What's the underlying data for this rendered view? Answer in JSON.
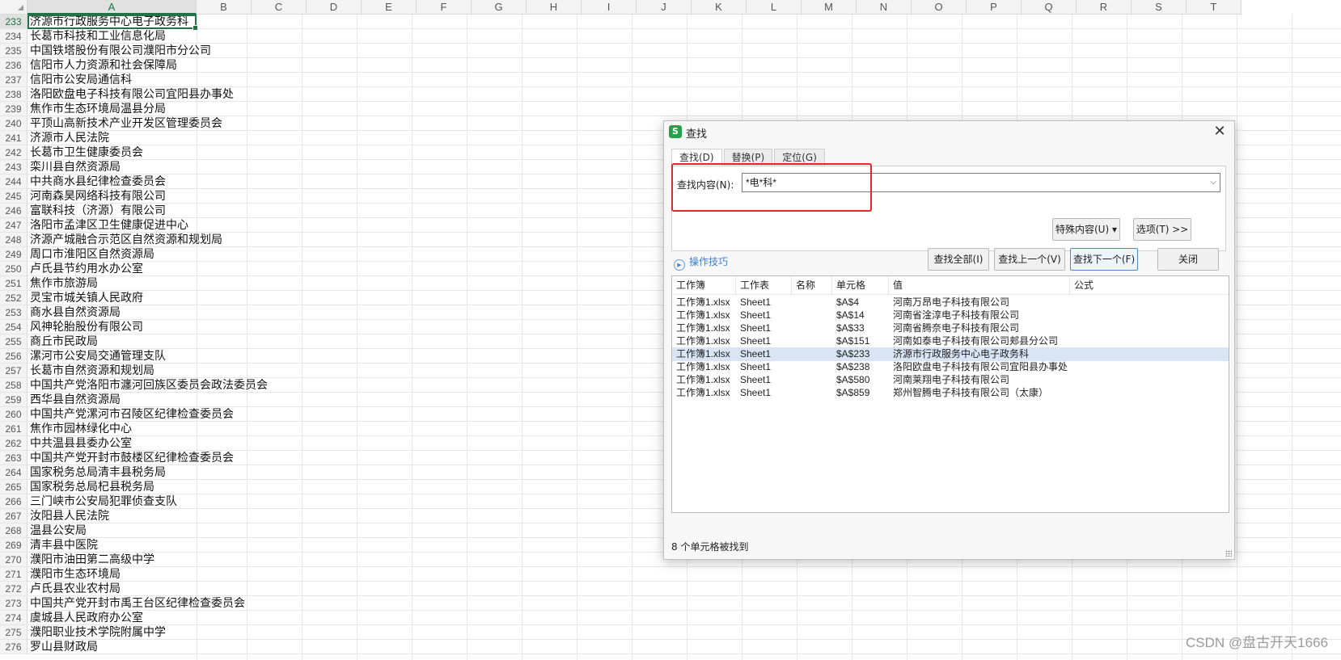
{
  "columns": [
    "A",
    "B",
    "C",
    "D",
    "E",
    "F",
    "G",
    "H",
    "I",
    "J",
    "K",
    "L",
    "M",
    "N",
    "O",
    "P",
    "Q",
    "R",
    "S",
    "T"
  ],
  "rows": [
    {
      "num": "233",
      "a": "济源市行政服务中心电子政务科"
    },
    {
      "num": "234",
      "a": "长葛市科技和工业信息化局"
    },
    {
      "num": "235",
      "a": "中国铁塔股份有限公司濮阳市分公司"
    },
    {
      "num": "236",
      "a": "信阳市人力资源和社会保障局"
    },
    {
      "num": "237",
      "a": "信阳市公安局通信科"
    },
    {
      "num": "238",
      "a": "洛阳欧盘电子科技有限公司宜阳县办事处"
    },
    {
      "num": "239",
      "a": "焦作市生态环境局温县分局"
    },
    {
      "num": "240",
      "a": "平顶山高新技术产业开发区管理委员会"
    },
    {
      "num": "241",
      "a": "济源市人民法院"
    },
    {
      "num": "242",
      "a": "长葛市卫生健康委员会"
    },
    {
      "num": "243",
      "a": "栾川县自然资源局"
    },
    {
      "num": "244",
      "a": "中共商水县纪律检查委员会"
    },
    {
      "num": "245",
      "a": "河南森昊网络科技有限公司"
    },
    {
      "num": "246",
      "a": "富联科技（济源）有限公司"
    },
    {
      "num": "247",
      "a": "洛阳市孟津区卫生健康促进中心"
    },
    {
      "num": "248",
      "a": "济源产城融合示范区自然资源和规划局"
    },
    {
      "num": "249",
      "a": "周口市淮阳区自然资源局"
    },
    {
      "num": "250",
      "a": "卢氏县节约用水办公室"
    },
    {
      "num": "251",
      "a": "焦作市旅游局"
    },
    {
      "num": "252",
      "a": "灵宝市城关镇人民政府"
    },
    {
      "num": "253",
      "a": "商水县自然资源局"
    },
    {
      "num": "254",
      "a": "风神轮胎股份有限公司"
    },
    {
      "num": "255",
      "a": "商丘市民政局"
    },
    {
      "num": "256",
      "a": "漯河市公安局交通管理支队"
    },
    {
      "num": "257",
      "a": "长葛市自然资源和规划局"
    },
    {
      "num": "258",
      "a": "中国共产党洛阳市瀍河回族区委员会政法委员会"
    },
    {
      "num": "259",
      "a": "西华县自然资源局"
    },
    {
      "num": "260",
      "a": "中国共产党漯河市召陵区纪律检查委员会"
    },
    {
      "num": "261",
      "a": "焦作市园林绿化中心"
    },
    {
      "num": "262",
      "a": "中共温县县委办公室"
    },
    {
      "num": "263",
      "a": "中国共产党开封市鼓楼区纪律检查委员会"
    },
    {
      "num": "264",
      "a": "国家税务总局清丰县税务局"
    },
    {
      "num": "265",
      "a": "国家税务总局杞县税务局"
    },
    {
      "num": "266",
      "a": "三门峡市公安局犯罪侦查支队"
    },
    {
      "num": "267",
      "a": "汝阳县人民法院"
    },
    {
      "num": "268",
      "a": "温县公安局"
    },
    {
      "num": "269",
      "a": "清丰县中医院"
    },
    {
      "num": "270",
      "a": "濮阳市油田第二高级中学"
    },
    {
      "num": "271",
      "a": "濮阳市生态环境局"
    },
    {
      "num": "272",
      "a": "卢氏县农业农村局"
    },
    {
      "num": "273",
      "a": "中国共产党开封市禹王台区纪律检查委员会"
    },
    {
      "num": "274",
      "a": "虞城县人民政府办公室"
    },
    {
      "num": "275",
      "a": "濮阳职业技术学院附属中学"
    },
    {
      "num": "276",
      "a": "罗山县财政局"
    }
  ],
  "dialog": {
    "app_icon": "S",
    "title": "查找",
    "close_label": "✕",
    "tabs": [
      "查找(D)",
      "替换(P)",
      "定位(G)"
    ],
    "find_label": "查找内容(N):",
    "find_value": "*电*科*",
    "dropdown_arrow": "⌵",
    "special_btn": "特殊内容(U) ▾",
    "options_btn": "选项(T) >>",
    "tips_label": "操作技巧",
    "find_all_btn": "查找全部(I)",
    "find_prev_btn": "查找上一个(V)",
    "find_next_btn": "查找下一个(F)",
    "close_btn": "关闭",
    "result_headers": [
      "工作簿",
      "工作表",
      "名称",
      "单元格",
      "值",
      "公式"
    ],
    "results": [
      {
        "book": "工作簿1.xlsx",
        "sheet": "Sheet1",
        "name": "",
        "cell": "$A$4",
        "value": "河南万昂电子科技有限公司",
        "formula": ""
      },
      {
        "book": "工作簿1.xlsx",
        "sheet": "Sheet1",
        "name": "",
        "cell": "$A$14",
        "value": "河南省淦淳电子科技有限公司",
        "formula": ""
      },
      {
        "book": "工作簿1.xlsx",
        "sheet": "Sheet1",
        "name": "",
        "cell": "$A$33",
        "value": "河南省腾奈电子科技有限公司",
        "formula": ""
      },
      {
        "book": "工作簿1.xlsx",
        "sheet": "Sheet1",
        "name": "",
        "cell": "$A$151",
        "value": "河南如泰电子科技有限公司郏县分公司",
        "formula": ""
      },
      {
        "book": "工作簿1.xlsx",
        "sheet": "Sheet1",
        "name": "",
        "cell": "$A$233",
        "value": "济源市行政服务中心电子政务科",
        "formula": ""
      },
      {
        "book": "工作簿1.xlsx",
        "sheet": "Sheet1",
        "name": "",
        "cell": "$A$238",
        "value": "洛阳欧盘电子科技有限公司宜阳县办事处",
        "formula": ""
      },
      {
        "book": "工作簿1.xlsx",
        "sheet": "Sheet1",
        "name": "",
        "cell": "$A$580",
        "value": "河南莱翔电子科技有限公司",
        "formula": ""
      },
      {
        "book": "工作簿1.xlsx",
        "sheet": "Sheet1",
        "name": "",
        "cell": "$A$859",
        "value": "郑州智腾电子科技有限公司（太康）",
        "formula": ""
      }
    ],
    "selected_result": 4,
    "status": "8 个单元格被找到"
  },
  "watermark": "CSDN @盘古开天1666",
  "colors": {
    "accent_green": "#217346",
    "highlight_red": "#e8262a",
    "selection_blue": "#d9e4f5"
  }
}
